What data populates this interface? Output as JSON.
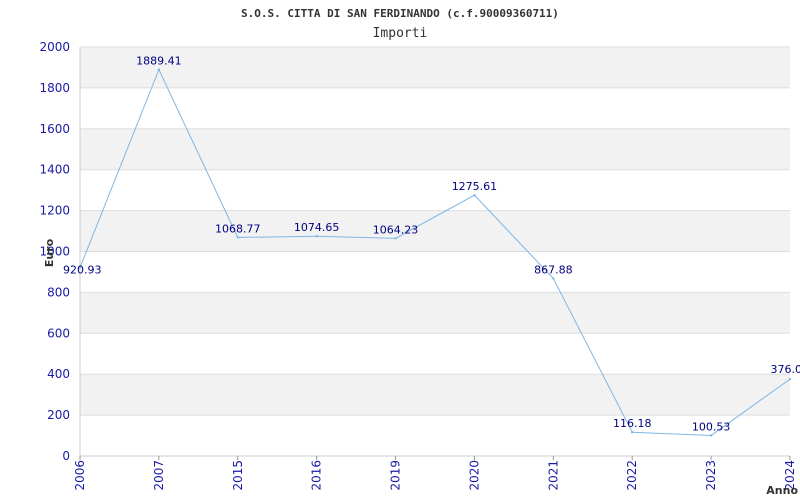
{
  "chart_data": {
    "type": "line",
    "title": "S.O.S. CITTA DI SAN FERDINANDO (c.f.90009360711)",
    "subtitle": "Importi",
    "xlabel": "Anno",
    "ylabel": "Euro",
    "categories": [
      "2006",
      "2007",
      "2015",
      "2016",
      "2019",
      "2020",
      "2021",
      "2022",
      "2023",
      "2024"
    ],
    "series": [
      {
        "values": [
          920.93,
          1889.41,
          1068.77,
          1074.65,
          1064.23,
          1275.61,
          867.88,
          116.18,
          100.53,
          376.0
        ],
        "labels": [
          "920.93",
          "1889.41",
          "1068.77",
          "1074.65",
          "1064.23",
          "1275.61",
          "867.88",
          "116.18",
          "100.53",
          "376.0"
        ]
      }
    ],
    "ylim": [
      0,
      2000
    ],
    "yticks": [
      0,
      200,
      400,
      600,
      800,
      1000,
      1200,
      1400,
      1600,
      1800,
      2000
    ],
    "grid": true,
    "colors": {
      "line": "#7fb7e6",
      "band": "#f2f2f2",
      "gridline": "#dddddd",
      "tick": "#1a1aa6",
      "label": "#000080"
    }
  }
}
